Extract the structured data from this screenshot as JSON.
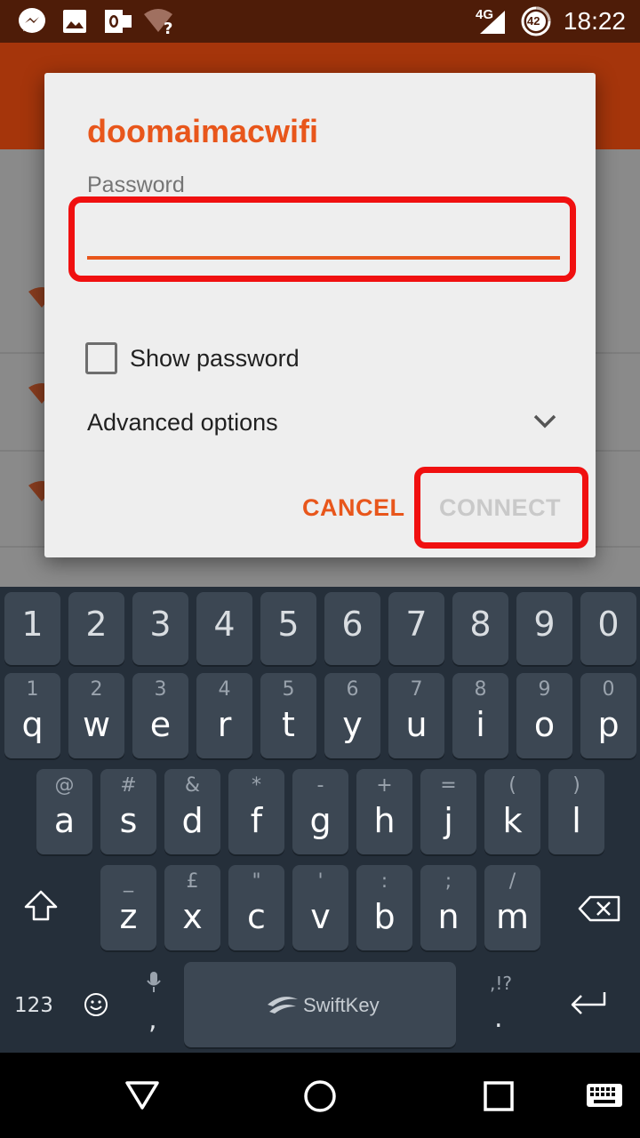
{
  "status_bar": {
    "time": "18:22",
    "network": "4G",
    "battery_level": "42",
    "icons": [
      "messenger-icon",
      "gallery-icon",
      "outlook-icon",
      "wifi-unknown-icon",
      "signal-icon",
      "battery-icon"
    ]
  },
  "dialog": {
    "title": "doomaimacwifi",
    "password_label": "Password",
    "password_value": "",
    "show_password_label": "Show password",
    "show_password_checked": false,
    "advanced_options_label": "Advanced options",
    "cancel_label": "CANCEL",
    "connect_label": "CONNECT",
    "connect_enabled": false
  },
  "keyboard": {
    "number_row": [
      "1",
      "2",
      "3",
      "4",
      "5",
      "6",
      "7",
      "8",
      "9",
      "0"
    ],
    "row1": [
      {
        "main": "q",
        "sub": "1"
      },
      {
        "main": "w",
        "sub": "2"
      },
      {
        "main": "e",
        "sub": "3"
      },
      {
        "main": "r",
        "sub": "4"
      },
      {
        "main": "t",
        "sub": "5"
      },
      {
        "main": "y",
        "sub": "6"
      },
      {
        "main": "u",
        "sub": "7"
      },
      {
        "main": "i",
        "sub": "8"
      },
      {
        "main": "o",
        "sub": "9"
      },
      {
        "main": "p",
        "sub": "0"
      }
    ],
    "row2": [
      {
        "main": "a",
        "sub": "@"
      },
      {
        "main": "s",
        "sub": "#"
      },
      {
        "main": "d",
        "sub": "&"
      },
      {
        "main": "f",
        "sub": "*"
      },
      {
        "main": "g",
        "sub": "-"
      },
      {
        "main": "h",
        "sub": "+"
      },
      {
        "main": "j",
        "sub": "="
      },
      {
        "main": "k",
        "sub": "("
      },
      {
        "main": "l",
        "sub": ")"
      }
    ],
    "row3": [
      {
        "main": "z",
        "sub": "_"
      },
      {
        "main": "x",
        "sub": "£"
      },
      {
        "main": "c",
        "sub": "\""
      },
      {
        "main": "v",
        "sub": "'"
      },
      {
        "main": "b",
        "sub": ":"
      },
      {
        "main": "n",
        "sub": ";"
      },
      {
        "main": "m",
        "sub": "/"
      }
    ],
    "symbols_label": "123",
    "comma_label": ",",
    "period_label": ".",
    "period_sub": ",!?",
    "spacebar_label": "SwiftKey"
  },
  "colors": {
    "accent": "#e8561b",
    "highlight": "#f01010",
    "keyboard_bg": "#252f3a",
    "key_bg": "#3c4753"
  }
}
